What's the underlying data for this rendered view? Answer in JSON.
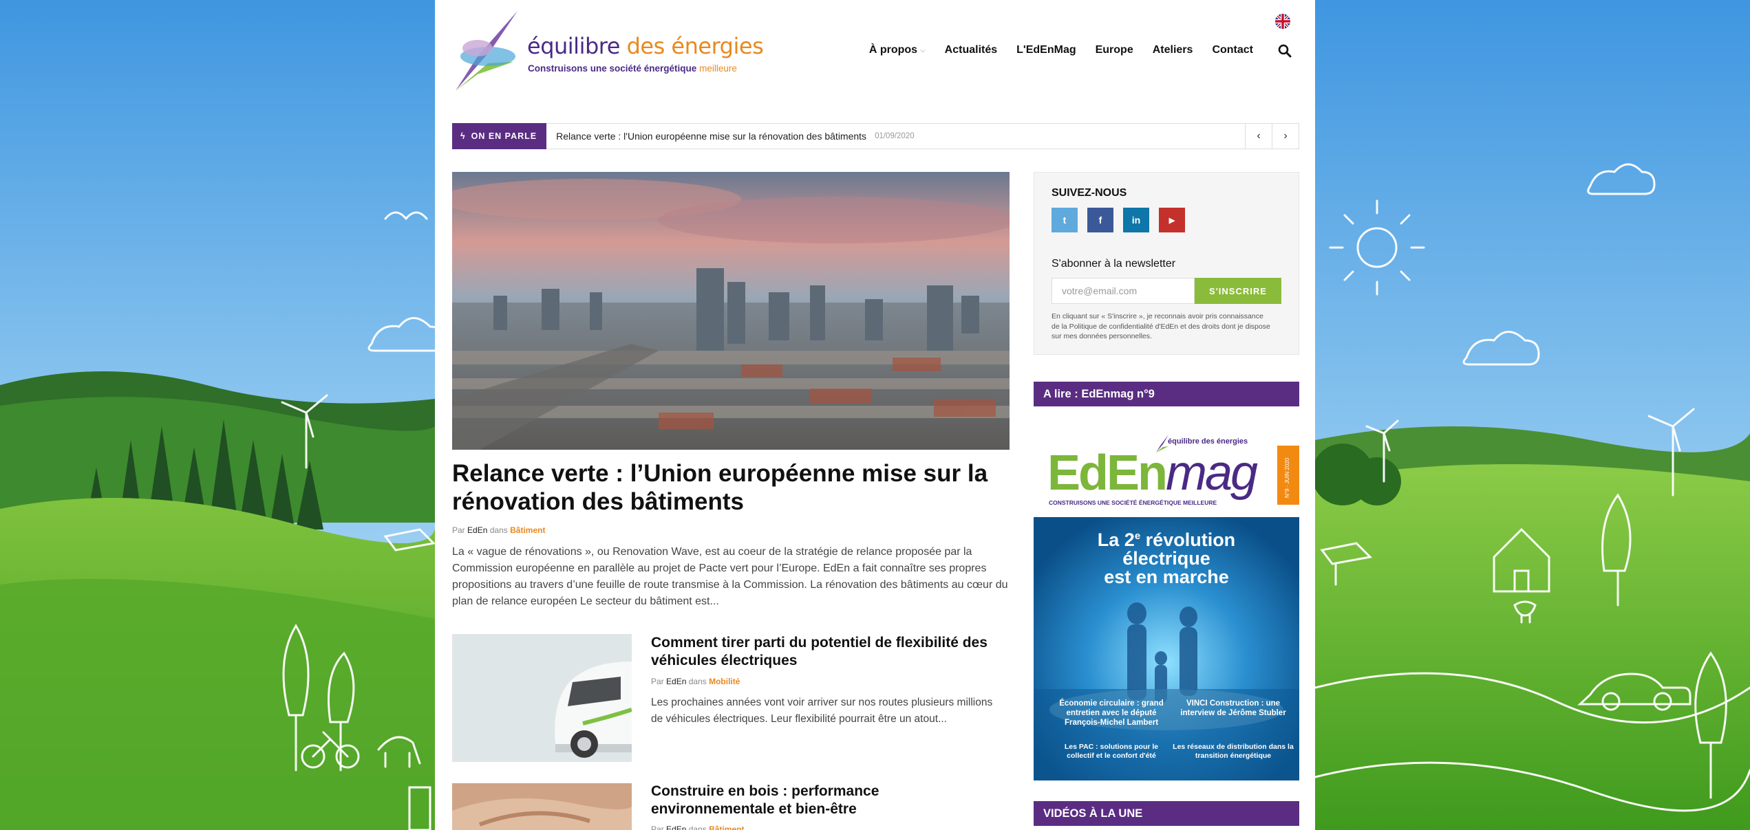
{
  "header": {
    "logo_word1": "équilibre",
    "logo_word2": "des énergies",
    "logo_tagline_main": "Construisons une société énergétique",
    "logo_tagline_accent": "meilleure",
    "nav": [
      "À propos",
      "Actualités",
      "L'EdEnMag",
      "Europe",
      "Ateliers",
      "Contact"
    ],
    "language_flag": "uk-flag-icon",
    "search_icon": "search-icon"
  },
  "ticker": {
    "label": "ON EN PARLE",
    "headline": "Relance verte : l'Union européenne mise sur la rénovation des bâtiments",
    "date": "01/09/2020"
  },
  "featured": {
    "title": "Relance verte : l’Union européenne mise sur la rénovation des bâtiments",
    "by": "Par",
    "author": "EdEn",
    "in": "dans",
    "category": "Bâtiment",
    "excerpt": "La « vague de rénovations », ou Renovation Wave, est au coeur de la stratégie de relance proposée par la Commission européenne en parallèle au projet de Pacte vert pour l’Europe. EdEn a fait connaître ses propres propositions au travers d’une feuille de route transmise à la Commission. La rénovation des bâtiments au cœur du plan de relance européen Le secteur du bâtiment est..."
  },
  "articles": [
    {
      "title": "Comment tirer parti du potentiel de flexibilité des véhicules électriques",
      "by": "Par",
      "author": "EdEn",
      "in": "dans",
      "category": "Mobilité",
      "excerpt": "Les prochaines années vont voir arriver sur nos routes plusieurs millions de véhicules électriques. Leur flexibilité pourrait être un atout..."
    },
    {
      "title": "Construire en bois : performance environnementale et bien-être",
      "by": "Par",
      "author": "EdEn",
      "in": "dans",
      "category": "Bâtiment"
    }
  ],
  "sidebar": {
    "follow_heading": "SUIVEZ-NOUS",
    "social": [
      "twitter-icon",
      "facebook-icon",
      "linkedin-icon",
      "youtube-icon"
    ],
    "social_labels": [
      "t",
      "f",
      "in",
      "▶"
    ],
    "social_colors": [
      "#5fa9dd",
      "#3b5998",
      "#0e76a8",
      "#c4302b"
    ],
    "newsletter_heading": "S'abonner à la newsletter",
    "newsletter_placeholder": "votre@email.com",
    "newsletter_button": "S'INSCRIRE",
    "newsletter_note": "En cliquant sur « S'inscrire », je reconnais avoir pris connaissance de la Politique de confidentialité d'EdEn et des droits dont je dispose sur mes données personnelles.",
    "mag_widget_title": "A lire : EdEnmag n°9",
    "mag": {
      "logo_small": "équilibre des énergies",
      "logo_ed": "EdEn",
      "logo_mag": "mag",
      "tagline": "CONSTRUISONS UNE SOCIÉTÉ ÉNERGÉTIQUE MEILLEURE",
      "issue": "N°9 · JUIN 2020",
      "cover_line1_a": "La 2",
      "cover_line1_sup": "e",
      "cover_line1_b": " révolution",
      "cover_line2": "électrique",
      "cover_line3": "est en marche",
      "teaser1": "Économie circulaire : grand entretien avec le député François-Michel Lambert",
      "teaser2": "VINCI Construction : une interview de Jérôme Stubler",
      "teaser3": "Les PAC : solutions pour le collectif et le confort d'été",
      "teaser4": "Les réseaux de distribution dans la transition énergétique"
    },
    "videos_widget_title": "VIDÉOS À LA UNE"
  },
  "colors": {
    "brand_purple": "#5a2d82",
    "brand_orange": "#e8891e",
    "brand_green": "#8bbb3a"
  }
}
